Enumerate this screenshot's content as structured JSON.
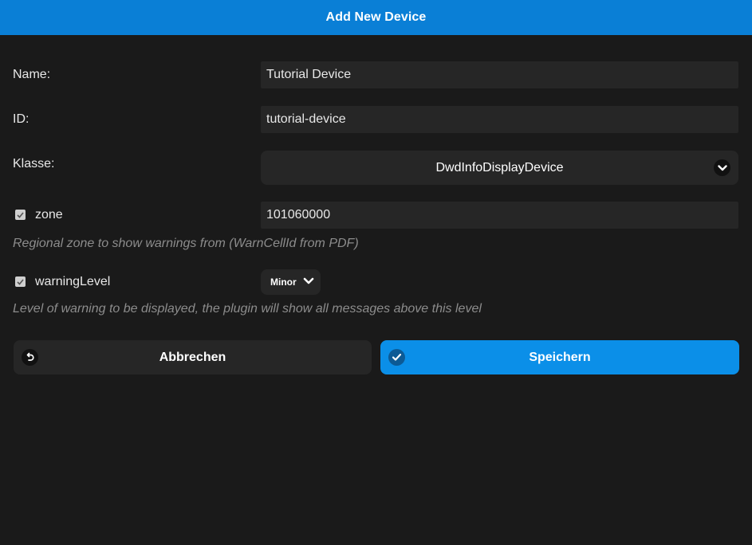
{
  "dialog": {
    "title": "Add New Device"
  },
  "form": {
    "name": {
      "label": "Name:",
      "value": "Tutorial Device"
    },
    "id": {
      "label": "ID:",
      "value": "tutorial-device"
    },
    "klasse": {
      "label": "Klasse:",
      "value": "DwdInfoDisplayDevice"
    },
    "zone": {
      "label": "zone",
      "checked": true,
      "value": "101060000",
      "hint": "Regional zone to show warnings from (WarnCellId from PDF)"
    },
    "warningLevel": {
      "label": "warningLevel",
      "checked": true,
      "value": "Minor",
      "hint": "Level of warning to be displayed, the plugin will show all messages above this level"
    }
  },
  "buttons": {
    "cancel_label": "Abbrechen",
    "save_label": "Speichern"
  },
  "colors": {
    "header": "#0a7fd6",
    "save_button": "#0b8fe8",
    "background": "#1a1a1a"
  },
  "icons": {
    "cancel": "undo-icon",
    "save": "check-icon",
    "dropdown": "chevron-down-icon",
    "checkbox": "checkmark-icon"
  }
}
